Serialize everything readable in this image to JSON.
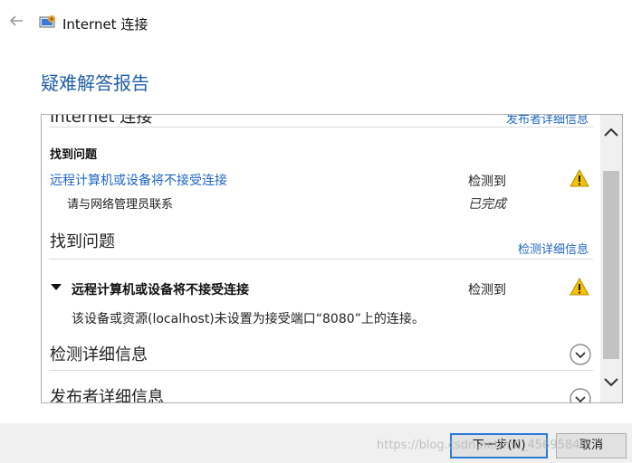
{
  "window": {
    "title": "Internet 连接"
  },
  "report": {
    "title": "疑难解答报告"
  },
  "panel": {
    "cut_heading": "Internet 连接",
    "cut_link": "发布者详细信息",
    "found_issues_bold": "找到问题",
    "issue1": {
      "label": "远程计算机或设备将不接受连接",
      "status": "检测到"
    },
    "action": {
      "label": "请与网络管理员联系",
      "status": "已完成"
    },
    "found_issues_heading": "找到问题",
    "detection_details_link": "检测详细信息",
    "issue2": {
      "title": "远程计算机或设备将不接受连接",
      "status": "检测到",
      "description": "该设备或资源(localhost)未设置为接受端口“8080”上的连接。"
    },
    "detection_details_heading": "检测详细信息",
    "publisher_details_heading": "发布者详细信息"
  },
  "footer": {
    "next_label": "下一步(N)",
    "cancel_label": "取消",
    "watermark": "https://blog.csdn.net/m0_45695848"
  },
  "icons": {
    "back": "back-arrow-icon",
    "app": "network-troubleshooter-icon",
    "warning": "warning-icon",
    "expand": "chevron-down-icon"
  },
  "colors": {
    "link": "#1f66c1",
    "title": "#1f5fa8",
    "warning": "#f2c200",
    "accent": "#2b7bd6"
  }
}
